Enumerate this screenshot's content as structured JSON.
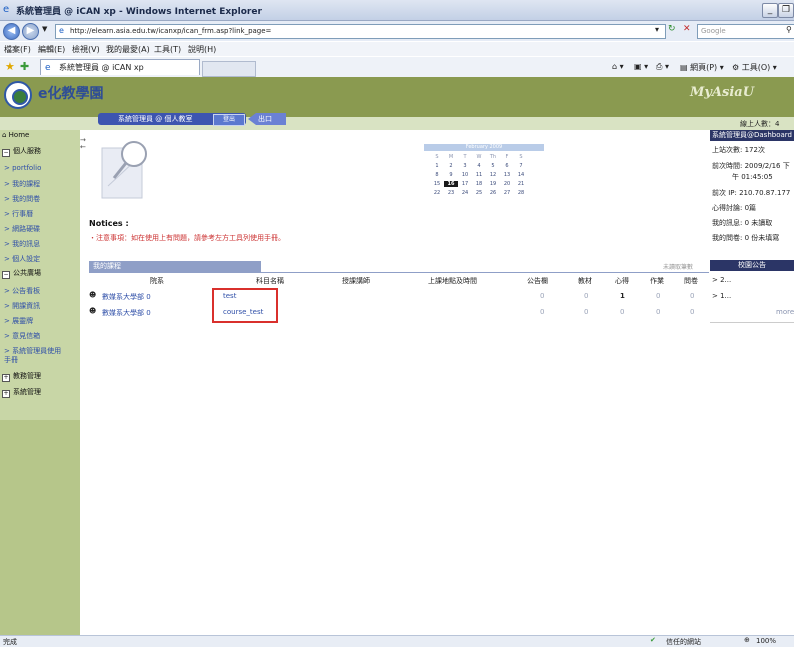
{
  "window": {
    "title": "系統管理員 @ iCAN xp - Windows Internet Explorer",
    "minimize": "_",
    "restore": "❐"
  },
  "address": {
    "url": "http://elearn.asia.edu.tw/icanxp/ican_frm.asp?link_page=",
    "search_placeholder": "Google"
  },
  "menu": [
    "檔案(F)",
    "編輯(E)",
    "檢視(V)",
    "我的最愛(A)",
    "工具(T)",
    "說明(H)"
  ],
  "tab": {
    "label": "系統管理員 @ iCAN xp"
  },
  "toolbar": {
    "page_label": "網頁(P)",
    "tools_label": "工具(O)"
  },
  "site": {
    "logo_text": "e化教學園",
    "brand": "MyAsiaU",
    "user_bar": "系統管理員 @ 個人教室",
    "logout": "登出",
    "exit": "出口",
    "online": "線上人數：4"
  },
  "sidebar": [
    {
      "label": "Home",
      "type": "home"
    },
    {
      "label": "個人服務",
      "type": "group"
    },
    {
      "label": "> portfolio",
      "type": "link"
    },
    {
      "label": "> 我的課程",
      "type": "link"
    },
    {
      "label": "> 我的問卷",
      "type": "link"
    },
    {
      "label": "> 行事曆",
      "type": "link"
    },
    {
      "label": "> 網路硬碟",
      "type": "link"
    },
    {
      "label": "> 我的訊息",
      "type": "link"
    },
    {
      "label": "> 個人設定",
      "type": "link"
    },
    {
      "label": "公共廣場",
      "type": "group"
    },
    {
      "label": "> 公告看板",
      "type": "link"
    },
    {
      "label": "> 開課資訊",
      "type": "link"
    },
    {
      "label": "> 展靈牌",
      "type": "link"
    },
    {
      "label": "> 意見信箱",
      "type": "link"
    },
    {
      "label": "> 系統管理員使用",
      "type": "link"
    },
    {
      "label": "手冊",
      "type": "link"
    },
    {
      "label": "教務管理",
      "type": "collapsed"
    },
    {
      "label": "系統管理",
      "type": "collapsed"
    }
  ],
  "calendar": {
    "title": "February 2009",
    "days": [
      "S",
      "M",
      "T",
      "W",
      "Th",
      "F",
      "S"
    ],
    "weeks": [
      [
        "1",
        "2",
        "3",
        "4",
        "5",
        "6",
        "7"
      ],
      [
        "8",
        "9",
        "10",
        "11",
        "12",
        "13",
        "14"
      ],
      [
        "15",
        "16",
        "17",
        "18",
        "19",
        "20",
        "21"
      ],
      [
        "22",
        "23",
        "24",
        "25",
        "26",
        "27",
        "28"
      ]
    ],
    "today": "16"
  },
  "notices": {
    "title": "Notices :",
    "text": "・注意事項：如在使用上有問題，請參考左方工具列使用手冊。"
  },
  "courses": {
    "title": "我的課程",
    "unread": "未讀取筆數",
    "headers": [
      "院系",
      "科目名稱",
      "授課講師",
      "上課地點及時間",
      "公告欄",
      "教材",
      "心得",
      "作業",
      "問卷"
    ],
    "rows": [
      {
        "dept": "數媒系大學部 0",
        "name": "test",
        "teacher": "",
        "place": "",
        "announce": "0",
        "material": "0",
        "notes": "1",
        "homework": "0",
        "survey": "0"
      },
      {
        "dept": "數媒系大學部 0",
        "name": "course_test",
        "teacher": "",
        "place": "",
        "announce": "0",
        "material": "0",
        "notes": "0",
        "homework": "0",
        "survey": "0"
      }
    ]
  },
  "dashboard": {
    "title": "系統管理員@Dashboard",
    "visits": "上站次數: 172次",
    "last_time_1": "前次時間: 2009/2/16 下",
    "last_time_2": "午 01:45:05",
    "last_ip": "前次 IP:  210.70.87.177",
    "discussion": "心得討論: 0篇",
    "messages": "我的訊息: 0 未讀取",
    "surveys": "我的問卷: 0 份未填寫"
  },
  "campus_news": {
    "title": "校園公告",
    "items": [
      "2...",
      "1..."
    ],
    "more": "more"
  },
  "status": {
    "left": "完成",
    "trusted": "信任的網站",
    "zoom": "100%"
  }
}
